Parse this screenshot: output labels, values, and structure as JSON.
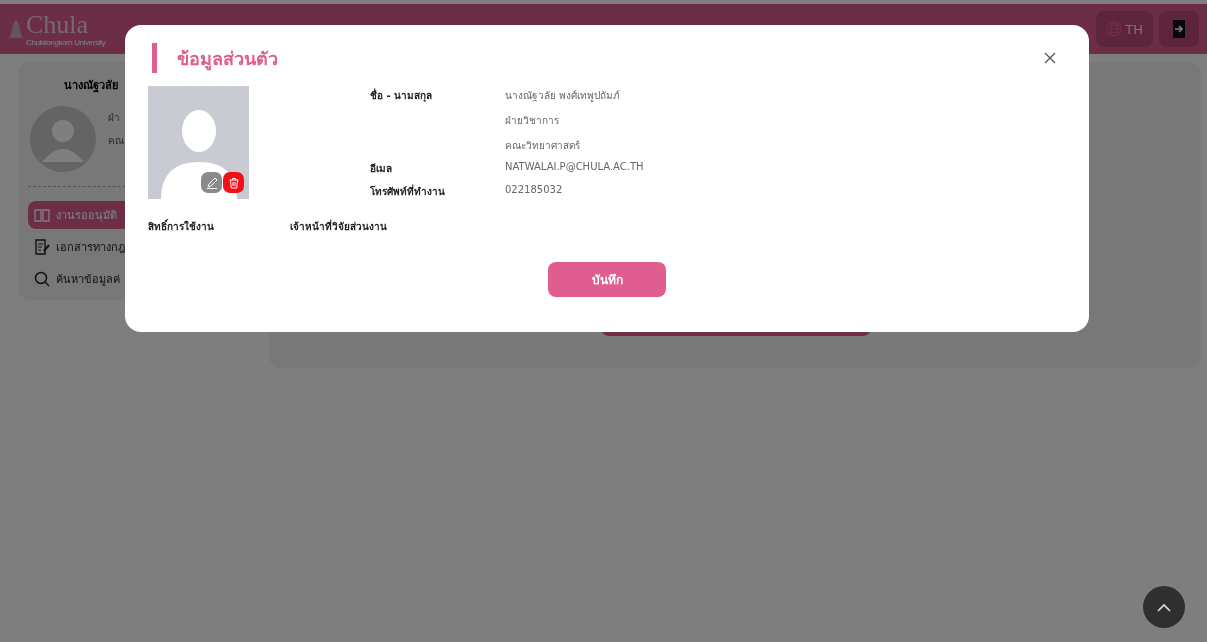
{
  "header": {
    "logo_text": "Chula",
    "logo_subtitle": "Chulalongkorn University",
    "language": "TH"
  },
  "sidebar": {
    "name": "นางณัฐวลัย",
    "lines": [
      "ฝ่า",
      "คณ"
    ],
    "menu": [
      {
        "label": "งานรออนุมัติ",
        "selected": true,
        "kind": "book"
      },
      {
        "label": "เอกสารทางกฎ",
        "selected": false,
        "kind": "document"
      },
      {
        "label": "ค้นหาข้อมูลค่",
        "selected": false,
        "kind": "search"
      }
    ]
  },
  "modal": {
    "title": "ข้อมูลส่วนตัว",
    "fields": [
      {
        "label": "ชื่อ - นามสกุล",
        "values": [
          "นางณัฐวลัย พงศ์เทพูปถัมภ์",
          "ฝ่ายวิชาการ",
          "คณะวิทยาศาสตร์"
        ]
      },
      {
        "label": "อีเมล",
        "values": [
          "NATWALAI.P@CHULA.AC.TH"
        ]
      },
      {
        "label": "โทรศัพท์ที่ทำงาน",
        "values": [
          "022185032"
        ]
      }
    ],
    "permission": {
      "label": "สิทธิ์การใช้งาน",
      "value": "เจ้าหน้าที่วิจัยส่วนงาน"
    },
    "save_button": "บันทึก"
  }
}
